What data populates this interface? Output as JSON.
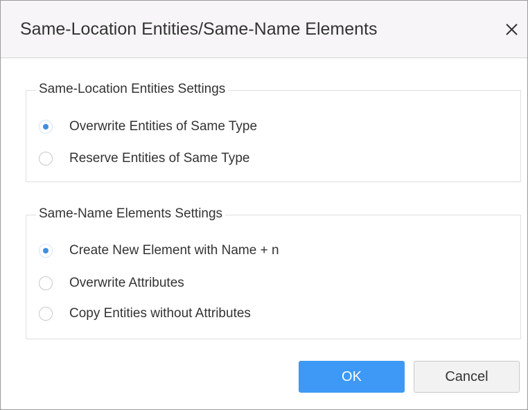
{
  "dialog": {
    "title": "Same-Location Entities/Same-Name Elements",
    "close_icon": "close-icon"
  },
  "location_settings": {
    "legend": "Same-Location Entities Settings",
    "options": [
      {
        "label": "Overwrite Entities of Same Type",
        "checked": true
      },
      {
        "label": "Reserve Entities of Same Type",
        "checked": false
      }
    ]
  },
  "name_settings": {
    "legend": "Same-Name Elements Settings",
    "options": [
      {
        "label": "Create New Element with Name + n",
        "checked": true
      },
      {
        "label": "Overwrite Attributes",
        "checked": false
      },
      {
        "label": "Copy Entities without Attributes",
        "checked": false
      }
    ]
  },
  "buttons": {
    "ok": "OK",
    "cancel": "Cancel"
  },
  "colors": {
    "primary": "#3d99f5",
    "radio_checked": "#3f8fe0",
    "titlebar_bg": "#f7f5f7"
  }
}
